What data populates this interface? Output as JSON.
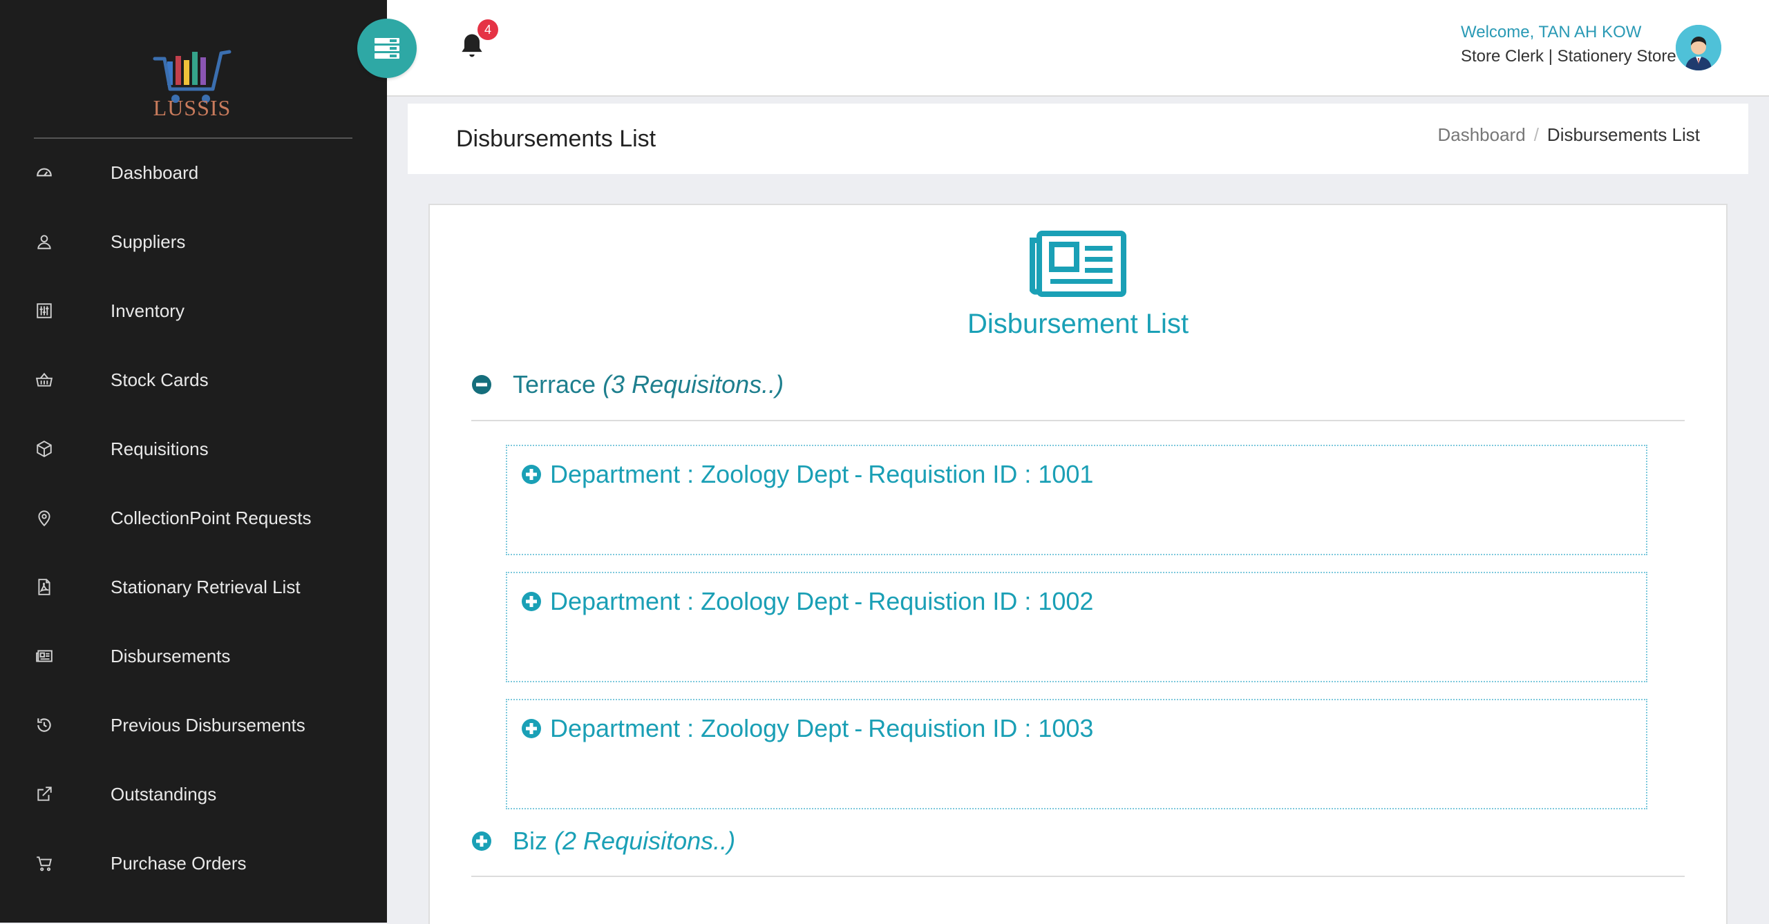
{
  "app": {
    "logo_text": "LUSSIS"
  },
  "sidebar": {
    "items": [
      {
        "label": "Dashboard",
        "icon": "dashboard-icon"
      },
      {
        "label": "Suppliers",
        "icon": "user-icon"
      },
      {
        "label": "Inventory",
        "icon": "sliders-icon"
      },
      {
        "label": "Stock Cards",
        "icon": "basket-icon"
      },
      {
        "label": "Requisitions",
        "icon": "box-icon"
      },
      {
        "label": "CollectionPoint Requests",
        "icon": "location-pin-icon"
      },
      {
        "label": "Stationary Retrieval List",
        "icon": "pdf-file-icon"
      },
      {
        "label": "Disbursements",
        "icon": "newspaper-icon"
      },
      {
        "label": "Previous Disbursements",
        "icon": "history-icon"
      },
      {
        "label": "Outstandings",
        "icon": "external-link-icon"
      },
      {
        "label": "Purchase Orders",
        "icon": "cart-icon"
      }
    ]
  },
  "header": {
    "notification_count": "4",
    "welcome": "Welcome, TAN AH KOW",
    "role": "Store Clerk | Stationery Store"
  },
  "page": {
    "title": "Disbursements List",
    "breadcrumb": [
      "Dashboard",
      "Disbursements List"
    ]
  },
  "main": {
    "title": "Disbursement List",
    "groups": [
      {
        "name": "Terrace",
        "count_label": "(3 Requisitons..)",
        "expanded": true,
        "requisitions": [
          {
            "dept_label": "Department :",
            "dept": "Zoology Dept",
            "id_label": "Requistion ID :",
            "id": "1001"
          },
          {
            "dept_label": "Department :",
            "dept": "Zoology Dept",
            "id_label": "Requistion ID :",
            "id": "1002"
          },
          {
            "dept_label": "Department :",
            "dept": "Zoology Dept",
            "id_label": "Requistion ID :",
            "id": "1003"
          }
        ]
      },
      {
        "name": "Biz",
        "count_label": "(2 Requisitons..)",
        "expanded": false,
        "requisitions": []
      }
    ]
  },
  "colors": {
    "sidebar_bg": "#1d1d1d",
    "accent": "#2ea8a5",
    "link_teal": "#1aa0b6",
    "badge_red": "#e53345"
  }
}
